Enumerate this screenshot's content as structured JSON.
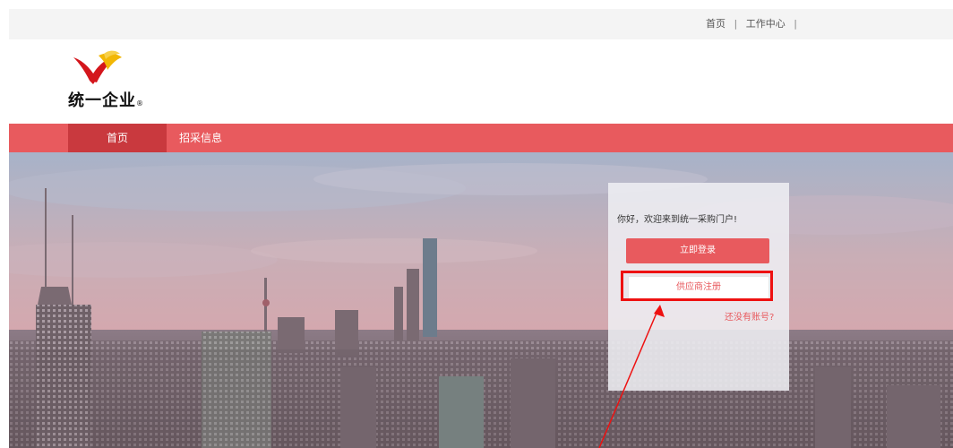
{
  "top_links": {
    "home": "首页",
    "work_center": "工作中心",
    "separator": "|"
  },
  "logo": {
    "brand_name": "统一企业",
    "registered": "®"
  },
  "nav": {
    "home": "首页",
    "bidding_info": "招采信息"
  },
  "login": {
    "greeting": "你好，欢迎来到统一采购门户!",
    "login_button": "立即登录",
    "register_button": "供应商注册",
    "no_account_link": "还没有账号?"
  },
  "colors": {
    "brand_red": "#e85a5e",
    "nav_active": "#c9393e",
    "annotation_red": "#ee1111"
  }
}
